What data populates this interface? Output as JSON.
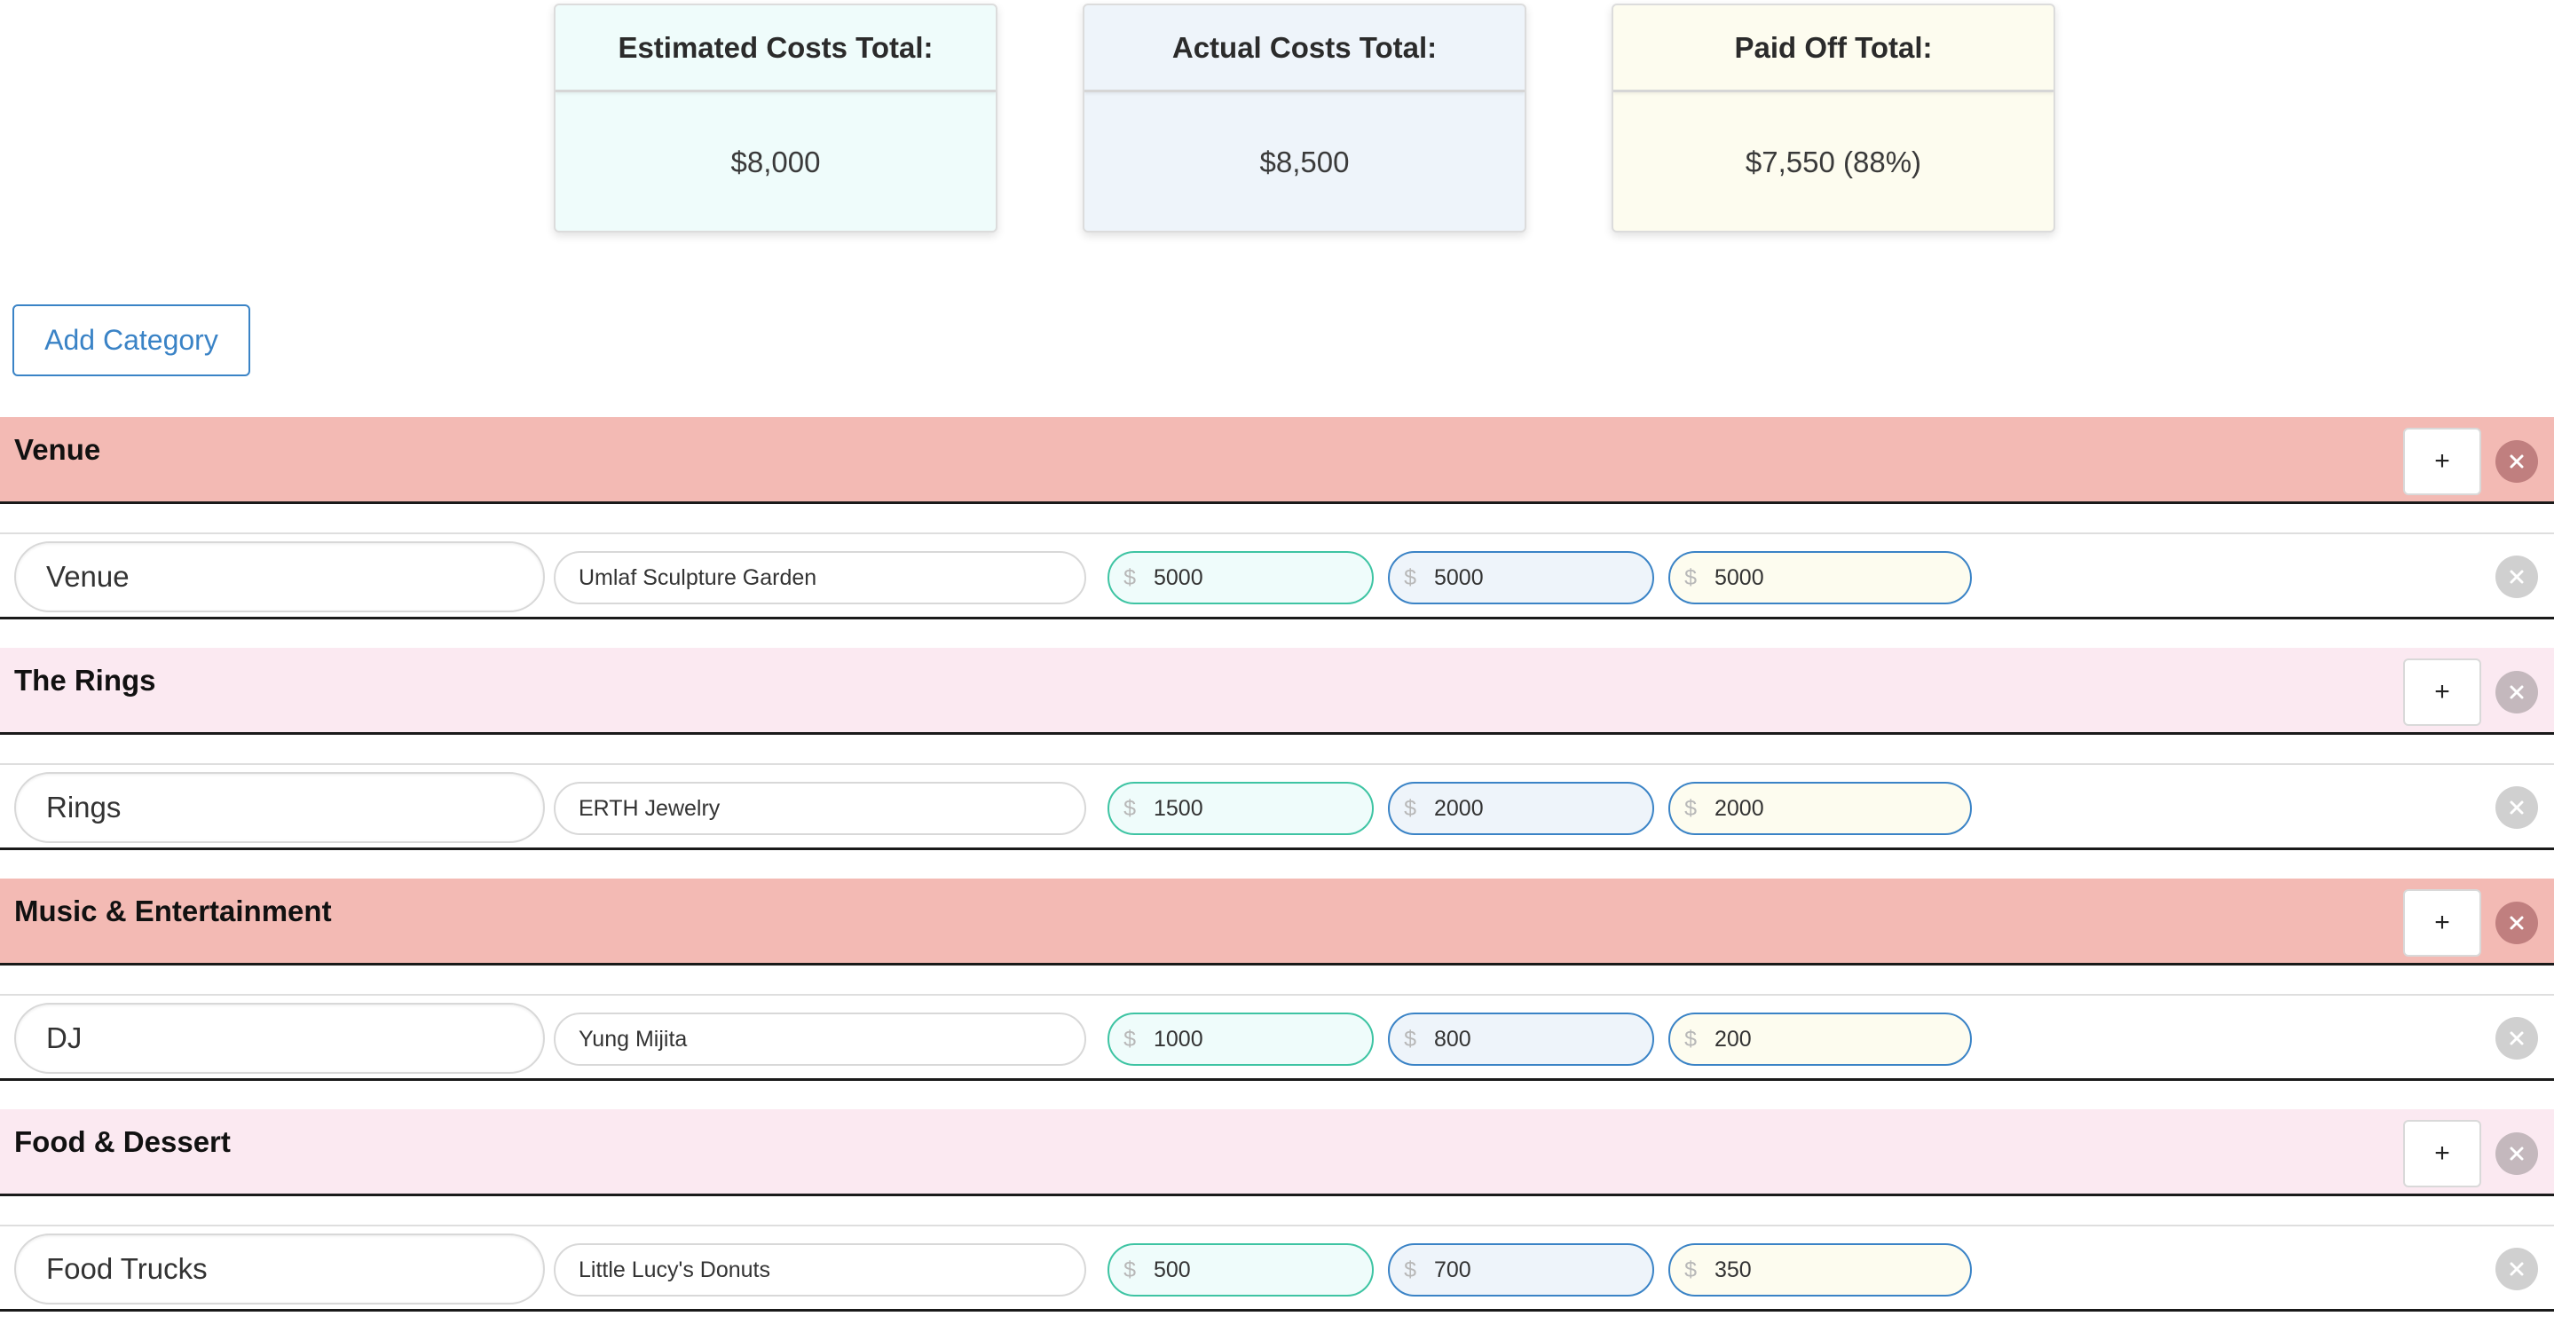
{
  "summary": {
    "estimated": {
      "label": "Estimated Costs Total:",
      "value": "$8,000"
    },
    "actual": {
      "label": "Actual Costs Total:",
      "value": "$8,500"
    },
    "paid": {
      "label": "Paid Off Total:",
      "value": "$7,550 (88%)"
    }
  },
  "add_category_label": "Add Category",
  "plus_label": "+",
  "currency_symbol": "$",
  "colors": {
    "header_red": "#f3bab4",
    "header_pink": "#fbe9f1",
    "estimated_bg": "#effcfb",
    "actual_bg": "#eef4fa",
    "paid_bg": "#fdfcef",
    "accent_blue": "#3a83c6",
    "accent_teal": "#3ec4a3"
  },
  "categories": [
    {
      "title": "Venue",
      "item": {
        "name": "Venue",
        "vendor": "Umlaf Sculpture Garden",
        "estimated": "5000",
        "actual": "5000",
        "paid": "5000"
      }
    },
    {
      "title": "The Rings",
      "item": {
        "name": "Rings",
        "vendor": "ERTH Jewelry",
        "estimated": "1500",
        "actual": "2000",
        "paid": "2000"
      }
    },
    {
      "title": "Music & Entertainment",
      "item": {
        "name": "DJ",
        "vendor": "Yung Mijita",
        "estimated": "1000",
        "actual": "800",
        "paid": "200"
      }
    },
    {
      "title": "Food & Dessert",
      "item": {
        "name": "Food Trucks",
        "vendor": "Little Lucy's Donuts",
        "estimated": "500",
        "actual": "700",
        "paid": "350"
      }
    }
  ]
}
